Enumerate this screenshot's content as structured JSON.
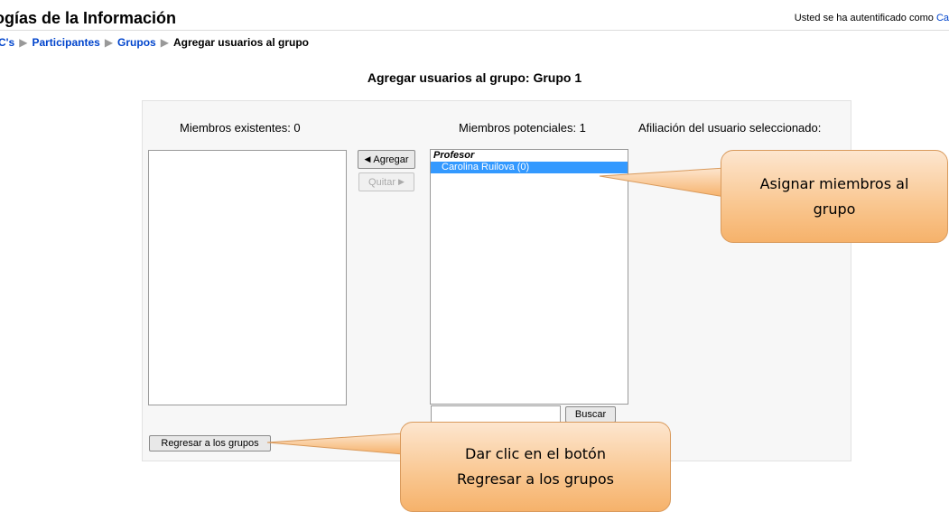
{
  "header": {
    "site_title": "ogías de la Información",
    "login_text": "Usted se ha autentificado como",
    "login_user": "Ca"
  },
  "breadcrumb": {
    "items": [
      "C's",
      "Participantes",
      "Grupos"
    ],
    "current": "Agregar usuarios al grupo",
    "separator": "▶"
  },
  "page": {
    "heading": "Agregar usuarios al grupo: Grupo 1"
  },
  "form": {
    "existing_label": "Miembros existentes: 0",
    "potential_label": "Miembros potenciales: 1",
    "affiliation_label": "Afiliación del usuario seleccionado:",
    "add_button": "Agregar",
    "remove_button": "Quitar",
    "potential_group": "Profesor",
    "potential_selected": "Carolina Ruilova (0)",
    "search_value": "",
    "search_button": "Buscar",
    "back_button": "Regresar a los grupos"
  },
  "callouts": {
    "assign_line1": "Asignar miembros al",
    "assign_line2": "grupo",
    "back_line1": "Dar clic en el botón",
    "back_line2": "Regresar a los grupos"
  },
  "colors": {
    "link": "#0044cc",
    "selection": "#3399ff",
    "callout_fill": "#f9c68f",
    "callout_border": "#d99a5c"
  },
  "icons": {
    "add_arrow": "◀",
    "remove_arrow": "▶"
  }
}
